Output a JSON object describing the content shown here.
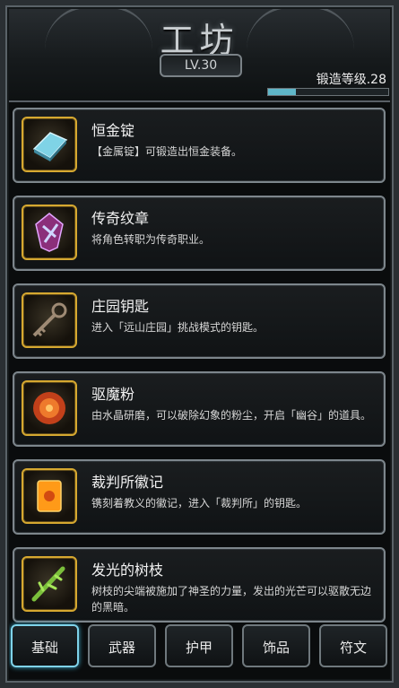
{
  "header": {
    "title": "工坊",
    "level_badge": "LV.30",
    "forge_level_label": "锻造等级.28",
    "forge_progress_percent": 23
  },
  "items": [
    {
      "name": "恒金锭",
      "desc": "【金属锭】可锻造出恒金装备。",
      "icon": "ingot-icon"
    },
    {
      "name": "传奇纹章",
      "desc": "将角色转职为传奇职业。",
      "icon": "emblem-icon"
    },
    {
      "name": "庄园钥匙",
      "desc": "进入「远山庄园」挑战模式的钥匙。",
      "icon": "key-icon"
    },
    {
      "name": "驱魔粉",
      "desc": "由水晶研磨，可以破除幻象的粉尘，开启「幽谷」的道具。",
      "icon": "powder-icon"
    },
    {
      "name": "裁判所徽记",
      "desc": "镌刻着教义的徽记，进入「裁判所」的钥匙。",
      "icon": "insignia-icon"
    },
    {
      "name": "发光的树枝",
      "desc": "树枝的尖端被施加了神圣的力量，发出的光芒可以驱散无边的黑暗。",
      "icon": "branch-icon"
    }
  ],
  "tabs": [
    {
      "label": "基础",
      "active": true
    },
    {
      "label": "武器",
      "active": false
    },
    {
      "label": "护甲",
      "active": false
    },
    {
      "label": "饰品",
      "active": false
    },
    {
      "label": "符文",
      "active": false
    }
  ],
  "colors": {
    "gold_border": "#d6a830",
    "active_tab": "#7fd3ea",
    "progress": "#5fb6c8"
  }
}
